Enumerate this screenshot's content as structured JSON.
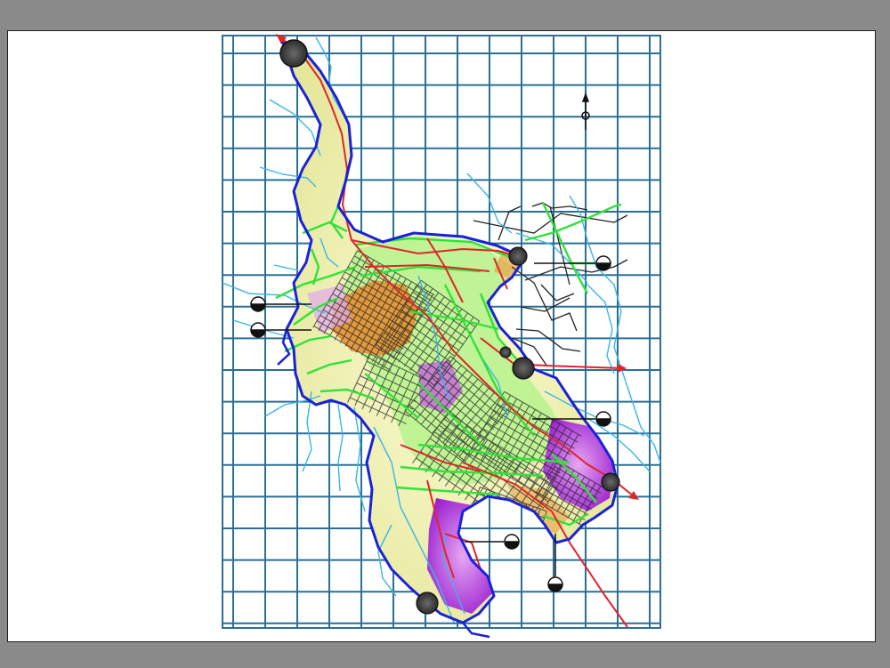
{
  "viewer": {
    "background_color": "#8a8a8a",
    "sheet_color": "#ffffff"
  },
  "map": {
    "type": "urban planning / zoning plan (CAD drawing)",
    "grid": {
      "shown": true,
      "color": "#2a6f96"
    },
    "colors": {
      "boundary": "#1a22d8",
      "roads_primary": "#e0242a",
      "roads_secondary": "#31e23a",
      "rivers": "#3bb5e6",
      "street_network": "#222222",
      "zone_commercial": "#e58a2e",
      "zone_residential": "#e9ec9a",
      "zone_special": "#b23bd8",
      "zone_green": "#9ef07a"
    },
    "markers": {
      "section_marker_icon": "section-cut-marker-icon",
      "node_icon": "gray-circle-node-icon",
      "north_arrow_icon": "north-arrow-icon",
      "section_marker_count": 7,
      "node_count": 6
    }
  }
}
